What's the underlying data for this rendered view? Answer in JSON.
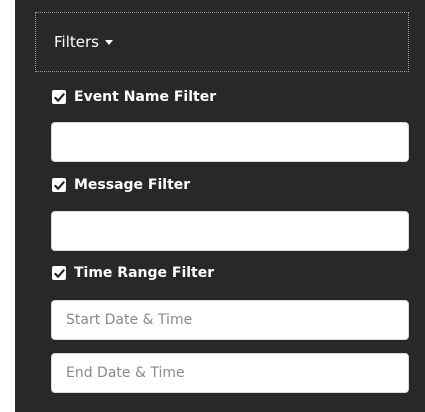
{
  "filters": {
    "toggle_label": "Filters",
    "event_name": {
      "label": "Event Name Filter",
      "checked": true,
      "value": "",
      "placeholder": ""
    },
    "message": {
      "label": "Message Filter",
      "checked": true,
      "value": "",
      "placeholder": ""
    },
    "time_range": {
      "label": "Time Range Filter",
      "checked": true,
      "start_placeholder": "Start Date & Time",
      "end_placeholder": "End Date & Time"
    }
  },
  "icons": {
    "toggle_caret": "caret-down-icon",
    "checkbox": "checkmark-icon"
  }
}
